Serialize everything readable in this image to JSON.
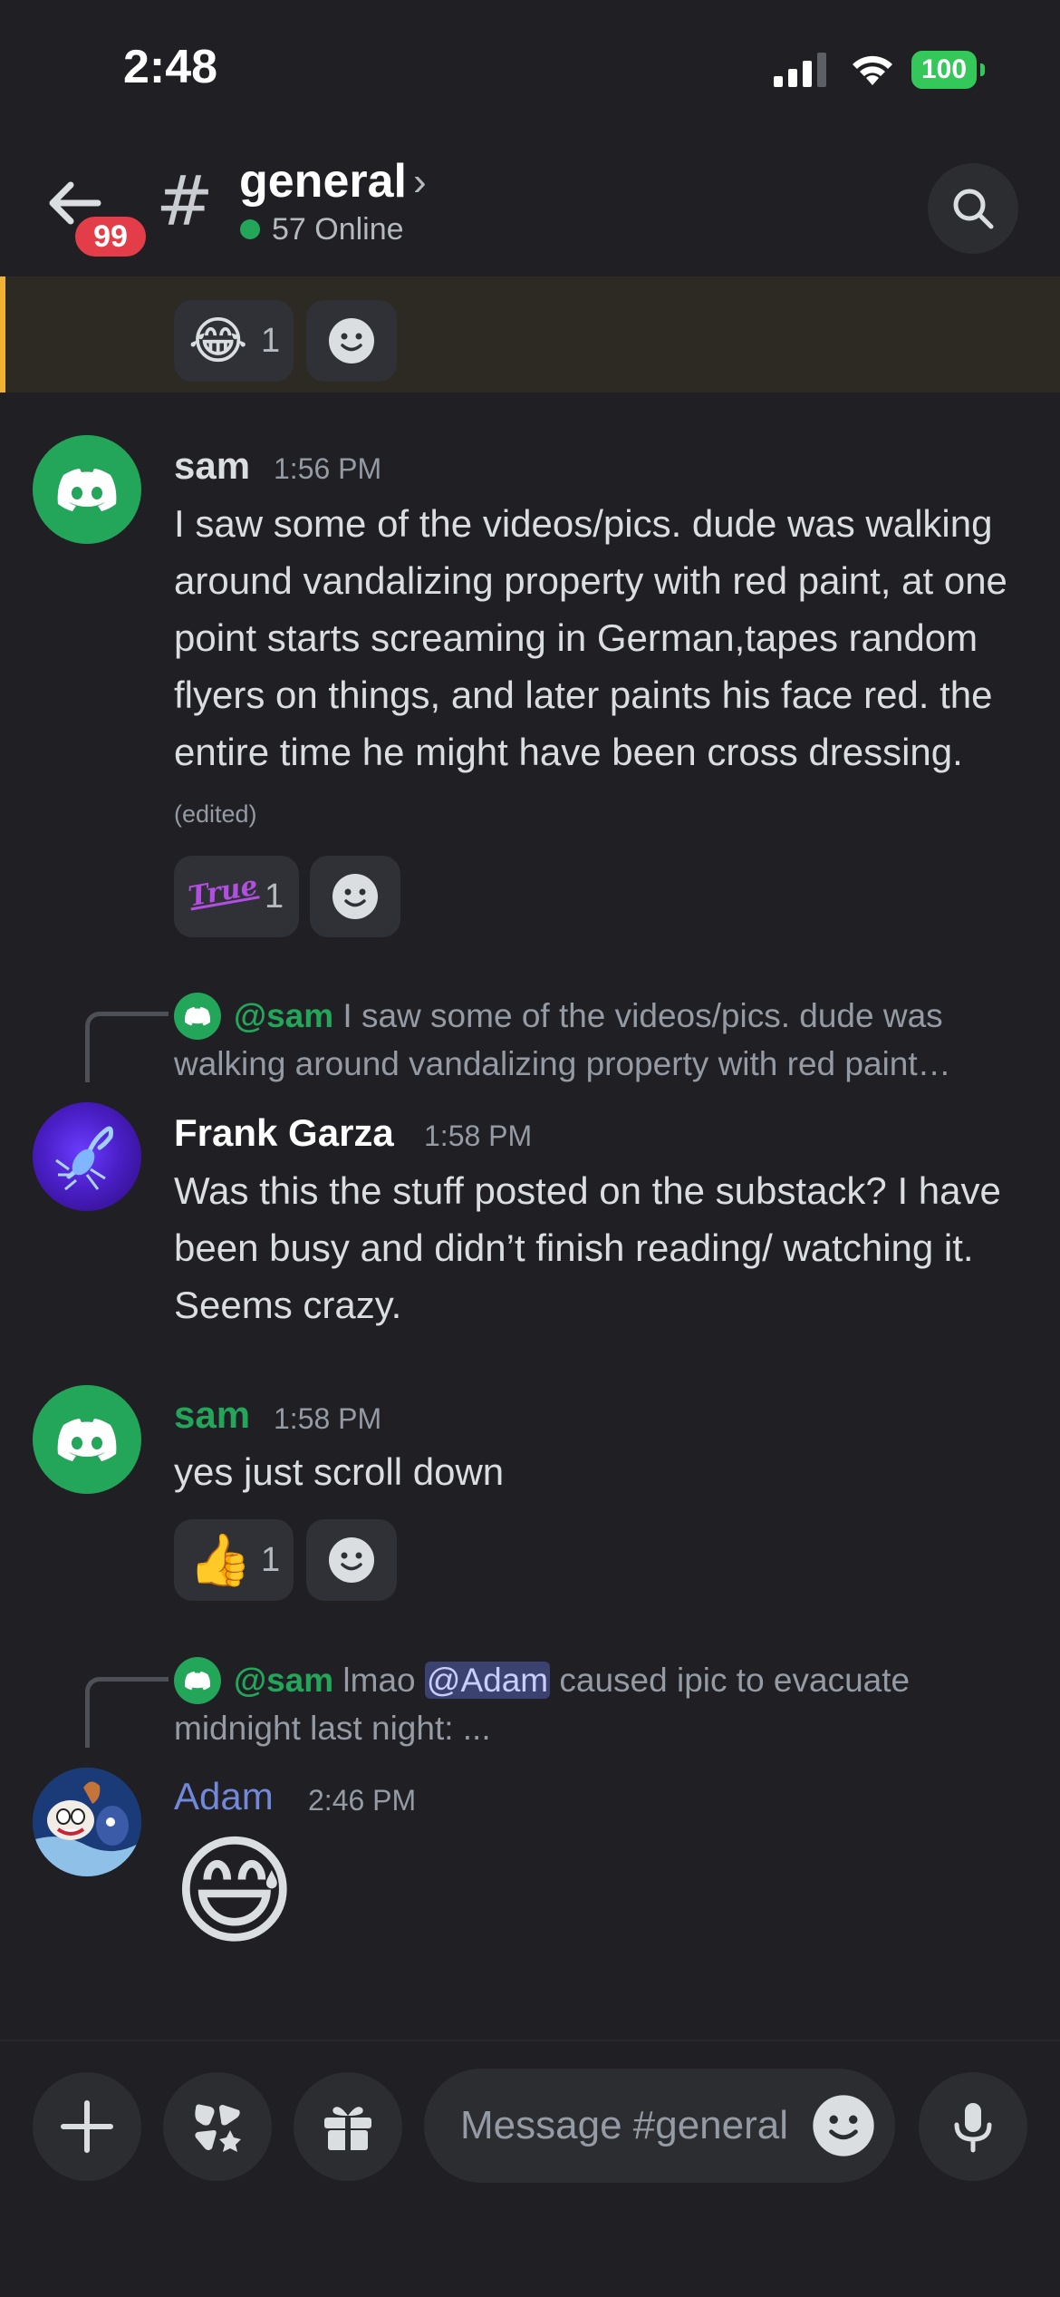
{
  "status_bar": {
    "time": "2:48",
    "battery": "100"
  },
  "header": {
    "unread_count": "99",
    "channel_name": "general",
    "online_text": "57 Online"
  },
  "highlighted_reactions": [
    {
      "emoji": "😂",
      "count": "1"
    }
  ],
  "messages": [
    {
      "author": "sam",
      "author_color": "#23a55a",
      "time": "1:56 PM",
      "text": "I saw some of the videos/pics. dude was walking around vandalizing property with red paint, at one point starts screaming in German,tapes random flyers on things, and later paints his face red. the entire time he might have been cross dressing.",
      "edited": "(edited)",
      "reaction": {
        "emoji": "True",
        "count": "1"
      }
    },
    {
      "reply_to": "@sam",
      "reply_text": "I saw some of the videos/pics. dude was walking around vandalizing property with red paint…",
      "author": "Frank Garza",
      "author_color": "#ffffff",
      "time": "1:58 PM",
      "text": "Was this the stuff posted on the substack? I have been busy and didn’t finish reading/ watching it. Seems crazy."
    },
    {
      "author": "sam",
      "author_color": "#23a55a",
      "time": "1:58 PM",
      "text": "yes just scroll down",
      "reaction": {
        "emoji": "👍",
        "count": "1"
      }
    },
    {
      "reply_to": "@sam",
      "reply_text_before": "lmao",
      "reply_mention": "@Adam",
      "reply_text_after": "caused ipic to evacuate midnight last night:   ...",
      "author": "Adam",
      "author_color": "#7289da",
      "time": "2:46 PM",
      "emoji": "😅"
    }
  ],
  "composer": {
    "placeholder": "Message #general"
  },
  "icons": {
    "back": "arrow-left-icon",
    "hash": "hash-icon",
    "search": "search-icon",
    "add_reaction": "smiley-icon",
    "plus": "plus-icon",
    "apps": "apps-icon",
    "gift": "gift-icon",
    "mic": "microphone-icon"
  }
}
